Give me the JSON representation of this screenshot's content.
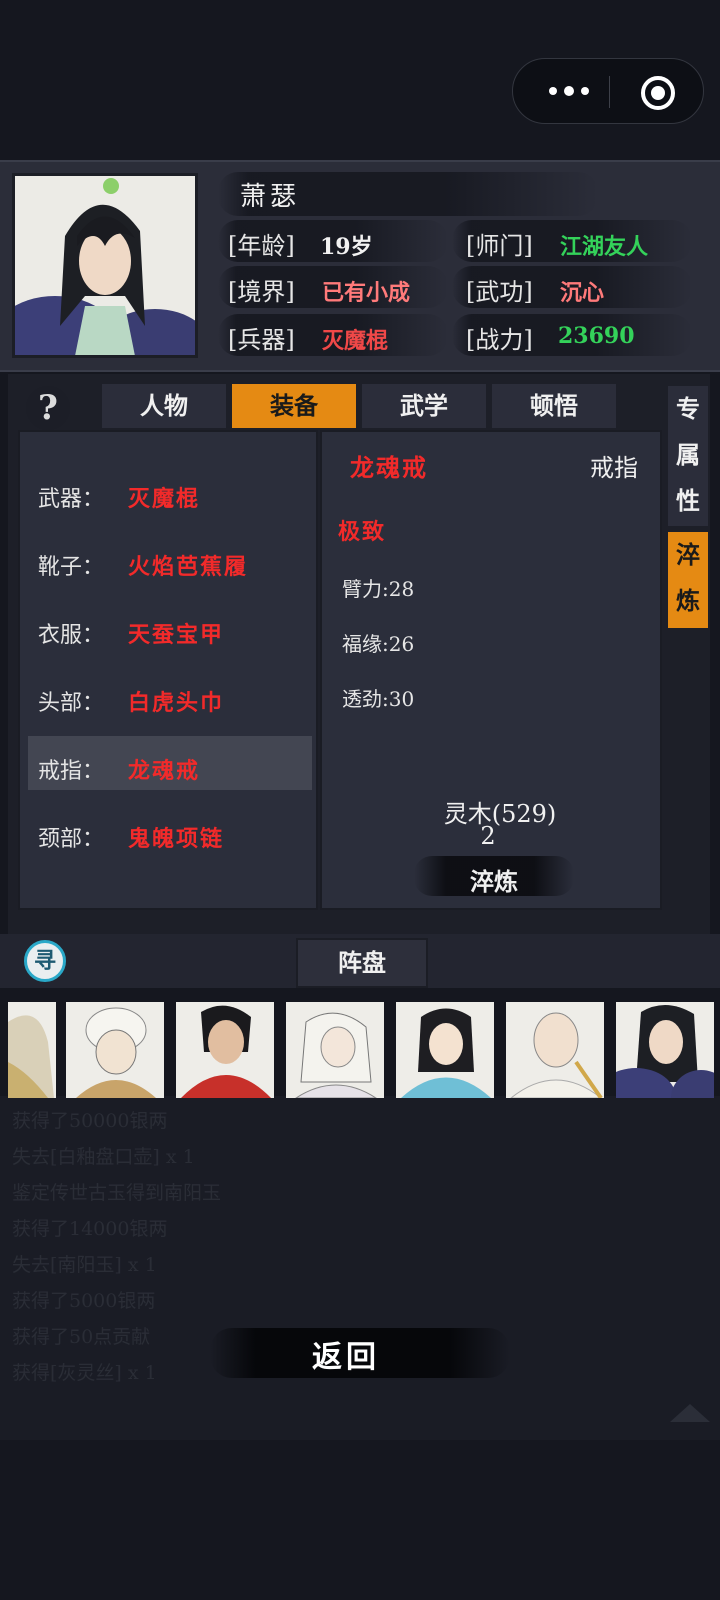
{
  "capsule": {
    "more_icon": "more-dots-icon",
    "close_icon": "target-icon"
  },
  "profile": {
    "name": "萧瑟",
    "age_label": "[年龄]",
    "age": "19岁",
    "sect_label": "[师门]",
    "sect": "江湖友人",
    "realm_label": "[境界]",
    "realm": "已有小成",
    "skill_label": "[武功]",
    "skill": "沉心",
    "weapon_label": "[兵器]",
    "weapon": "灭魔棍",
    "power_label": "[战力]",
    "power": "23690"
  },
  "help_icon": "?",
  "tabs": [
    {
      "label": "人物",
      "active": false
    },
    {
      "label": "装备",
      "active": true
    },
    {
      "label": "武学",
      "active": false
    },
    {
      "label": "顿悟",
      "active": false
    }
  ],
  "side_tabs": [
    {
      "label": "专属性",
      "active": false
    },
    {
      "label": "淬炼",
      "active": true
    }
  ],
  "equipment": [
    {
      "slot": "武器：",
      "item": "灭魔棍"
    },
    {
      "slot": "靴子：",
      "item": "火焰芭蕉履"
    },
    {
      "slot": "衣服：",
      "item": "天蚕宝甲"
    },
    {
      "slot": "头部：",
      "item": "白虎头巾"
    },
    {
      "slot": "戒指：",
      "item": "龙魂戒"
    },
    {
      "slot": "颈部：",
      "item": "鬼魄项链"
    }
  ],
  "detail": {
    "name": "龙魂戒",
    "type": "戒指",
    "quality": "极致",
    "stats": [
      "臂力:28",
      "福缘:26",
      "透劲:30"
    ],
    "material": "灵木(529)",
    "cost": "2",
    "refine_button": "淬炼"
  },
  "bottom": {
    "xun_icon": "寻",
    "zhenpan": "阵盘"
  },
  "log": [
    "获得了50000银两",
    "失去[白釉盘口壶] x 1",
    "鉴定传世古玉得到南阳玉",
    "获得了14000银两",
    "失去[南阳玉] x 1",
    "获得了5000银两",
    "获得了50点贡献",
    "获得[灰灵丝] x 1"
  ],
  "back_button": "返回",
  "colors": {
    "accent": "#e58a13",
    "red": "#f22a2a",
    "green": "#34d25a",
    "pink": "#ff7a7a",
    "bg": "#15171f"
  }
}
